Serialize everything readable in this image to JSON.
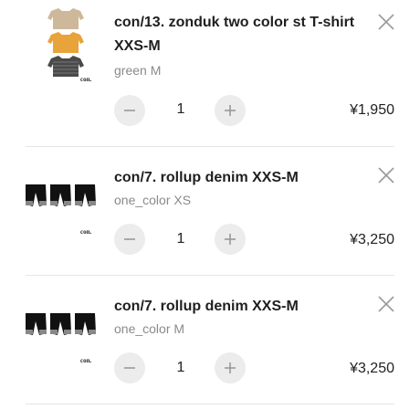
{
  "items": [
    {
      "title": "con/13. zonduk two color st T-shirt XXS-M",
      "variant": "green M",
      "quantity": "1",
      "price": "¥1,950",
      "brand_mark": "con.",
      "thumbnail": "three-long-sleeve-tshirts"
    },
    {
      "title": "con/7. rollup denim XXS-M",
      "variant": "one_color XS",
      "quantity": "1",
      "price": "¥3,250",
      "brand_mark": "con.",
      "thumbnail": "three-black-denim-shorts"
    },
    {
      "title": "con/7. rollup denim XXS-M",
      "variant": "one_color M",
      "quantity": "1",
      "price": "¥3,250",
      "brand_mark": "con.",
      "thumbnail": "three-black-denim-shorts"
    }
  ],
  "icons": {
    "remove": "close-icon",
    "decrease": "minus-icon",
    "increase": "plus-icon"
  },
  "colors": {
    "stepper_bg": "#ececec",
    "icon": "#9a9a9a",
    "divider": "#e6e6e6",
    "variant_text": "#8a8a8a"
  }
}
